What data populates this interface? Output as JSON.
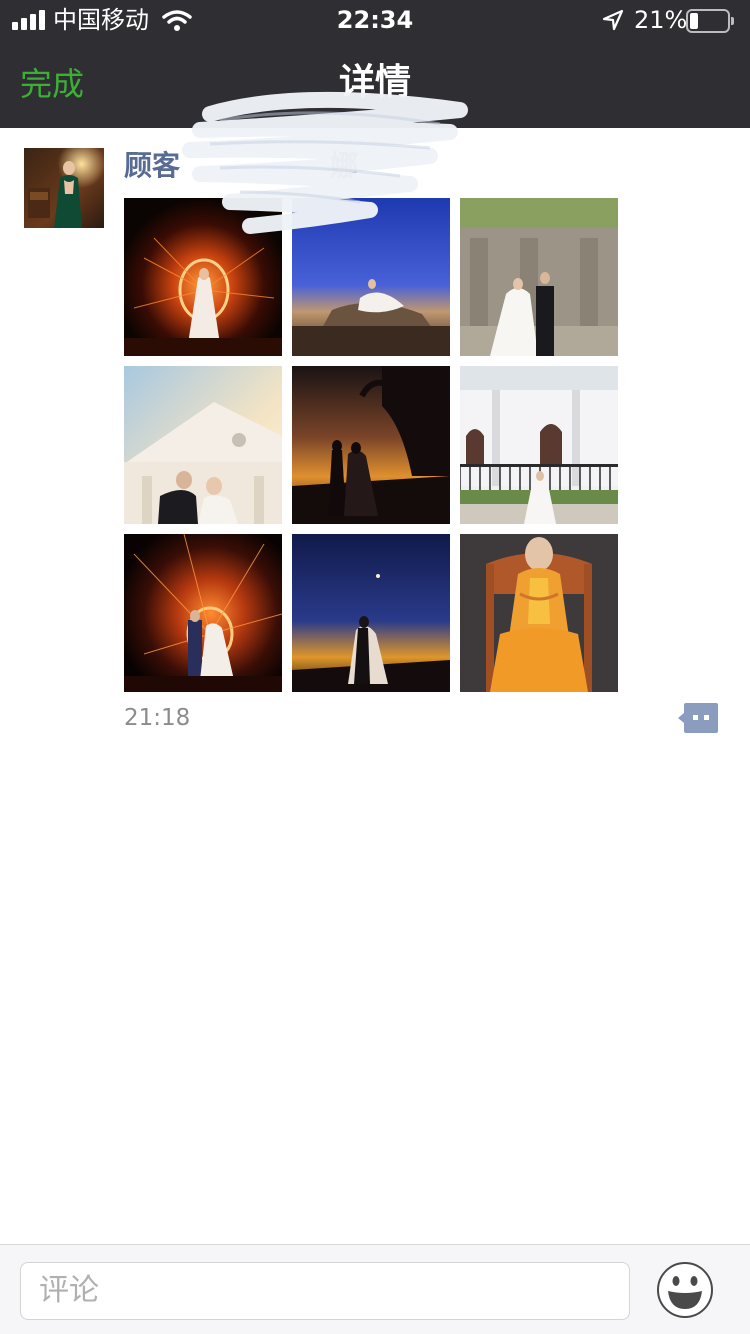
{
  "status_bar": {
    "carrier": "中国移动",
    "time": "22:34",
    "battery_percent": "21%",
    "battery_level": 0.21,
    "signal_icon": "signal-bars-icon",
    "wifi_icon": "wifi-icon",
    "location_icon": "location-arrow-icon",
    "battery_icon": "battery-icon"
  },
  "nav": {
    "done_label": "完成",
    "title": "详情"
  },
  "post": {
    "author_name": "顾客",
    "author_name_tail": "娜",
    "timestamp": "21:18",
    "photo_count": 9,
    "comment_icon": "comment-bubble-icon"
  },
  "composer": {
    "placeholder": "评论",
    "emoji_icon": "emoji-face-icon"
  },
  "colors": {
    "nav_bg": "#2e2e33",
    "accent_green": "#3cb035",
    "name_blue": "#576b95",
    "timestamp_gray": "#8c8c8c"
  }
}
